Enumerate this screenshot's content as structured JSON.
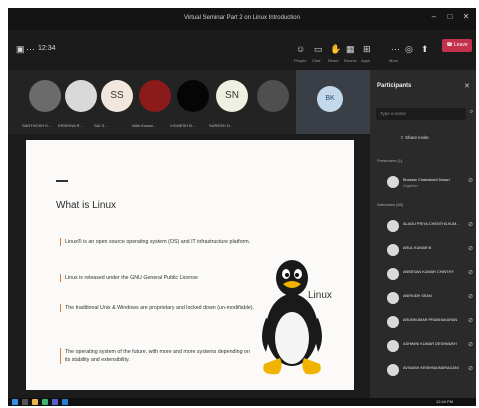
{
  "window": {
    "title": "Virtual Seminar Part 2 on Linux Introduction"
  },
  "toolbar": {
    "time": "12:34",
    "leave_label": "Leave",
    "labels": [
      "People",
      "Chat",
      "React",
      "Rooms",
      "Apps",
      "More"
    ]
  },
  "tiles": [
    {
      "name": "SANTHOSH K...",
      "bg": "#6b6b6b",
      "initials": ""
    },
    {
      "name": "KRISHNA R...",
      "bg": "#d9d9d9",
      "initials": ""
    },
    {
      "name": "SAI S...",
      "bg": "#f2e6df",
      "initials": "SS"
    },
    {
      "name": "Nitin Kumar...",
      "bg": "#8c1a1a",
      "initials": ""
    },
    {
      "name": "VIGNESH B...",
      "bg": "#050505",
      "initials": ""
    },
    {
      "name": "SURESH N...",
      "bg": "#eef0e2",
      "initials": "SN"
    },
    {
      "name": "",
      "bg": "#4f4f4f",
      "initials": ""
    }
  ],
  "self_tile": {
    "initials": "BK"
  },
  "slide": {
    "title": "What is Linux",
    "bullets": [
      "Linux® is an open source operating system (OS) and IT infrastructure platform.",
      "Linux is released under the GNU General Public License",
      "The traditional Unix & Windows are proprietary and locked down (un-modifiable).",
      "The operating system of the future, with more and more systems depending on its stability and extensibility."
    ],
    "logo_text": "Linux"
  },
  "sidebar": {
    "title": "Participants",
    "search_placeholder": "Type a name",
    "share_label": "Share invite",
    "presenters_label": "Presenters (1)",
    "attendees_label": "Attendees (65)",
    "presenter": {
      "name": "Bhaskar Chakrabarti Dasari",
      "role": "Organizer"
    },
    "attendees": [
      "ALAGU PRIYA CHENTHILKUM...",
      "ARUL KUMAR B",
      "ANBESAN KUMAR CHINTHY",
      "ANIRUDH SEAN",
      "ARUNKUMAR PRABHAKARAN",
      "ASHWINI KUMAR DESHMUKH",
      "AVINASH KRISHNA BAIRAGANI"
    ]
  },
  "taskbar": {
    "time": "12:44 PM"
  },
  "colors": {
    "leave": "#c4314b",
    "accent": "#e07b3a",
    "panel": "#2a2a2a"
  }
}
